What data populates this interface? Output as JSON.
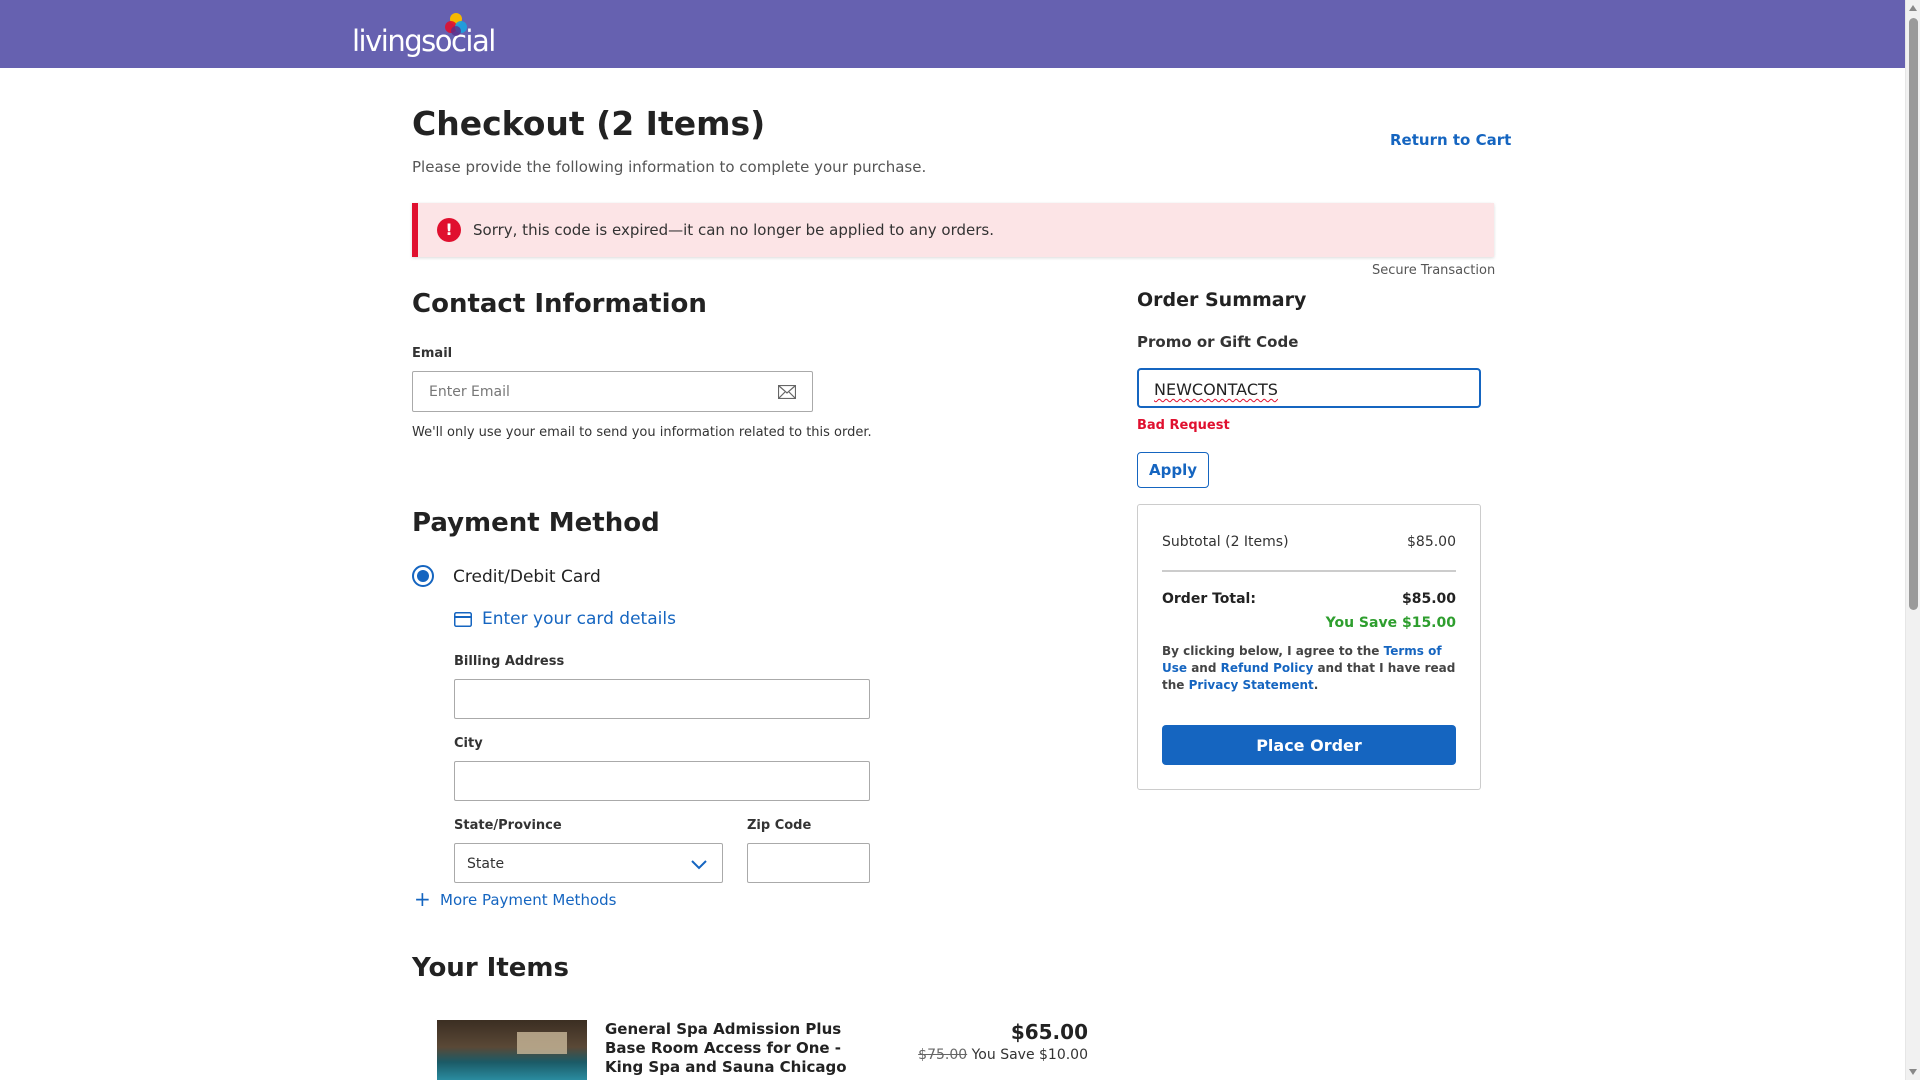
{
  "header": {
    "logo_text": "livingsocial",
    "colors": {
      "bg": "#6661b0"
    }
  },
  "page": {
    "title": "Checkout (2 Items)",
    "subtitle": "Please provide the following information to complete your purchase.",
    "return_link": "Return to Cart"
  },
  "alert": {
    "icon": "!",
    "message": "Sorry, this code is expired—it can no longer be applied to any orders."
  },
  "secure_text": "Secure Transaction",
  "contact": {
    "title": "Contact Information",
    "email_label": "Email",
    "email_placeholder": "Enter Email",
    "email_help": "We'll only use your email to send you information related to this order."
  },
  "payment": {
    "title": "Payment Method",
    "option_label": "Credit/Debit Card",
    "card_link": "Enter your card details",
    "billing_label": "Billing Address",
    "city_label": "City",
    "state_label": "State/Province",
    "state_value": "State",
    "zip_label": "Zip Code",
    "more_methods": "More Payment Methods"
  },
  "items": {
    "title": "Your Items",
    "list": [
      {
        "title": "General Spa Admission Plus Base Room Access for One - King Spa and Sauna Chicago",
        "price": "$65.00",
        "original": "$75.00",
        "savings": "You Save $10.00"
      }
    ]
  },
  "order_summary": {
    "title": "Order Summary",
    "promo_label": "Promo or Gift Code",
    "promo_value": "NEWCONTACTS",
    "promo_error": "Bad Request",
    "apply_label": "Apply",
    "subtotal_label": "Subtotal (2 Items)",
    "subtotal_value": "$85.00",
    "total_label": "Order Total:",
    "total_value": "$85.00",
    "savings": "You Save $15.00",
    "legal": {
      "p1": "By clicking below, I agree to the ",
      "terms": "Terms of Use",
      "p2": " and ",
      "refund": "Refund Policy",
      "p3": " and that I have read the ",
      "privacy": "Privacy Statement",
      "p4": "."
    },
    "place_order": "Place Order"
  },
  "colors": {
    "accent": "#1565c0",
    "error": "#e0102f",
    "success": "#2e9e2e"
  }
}
